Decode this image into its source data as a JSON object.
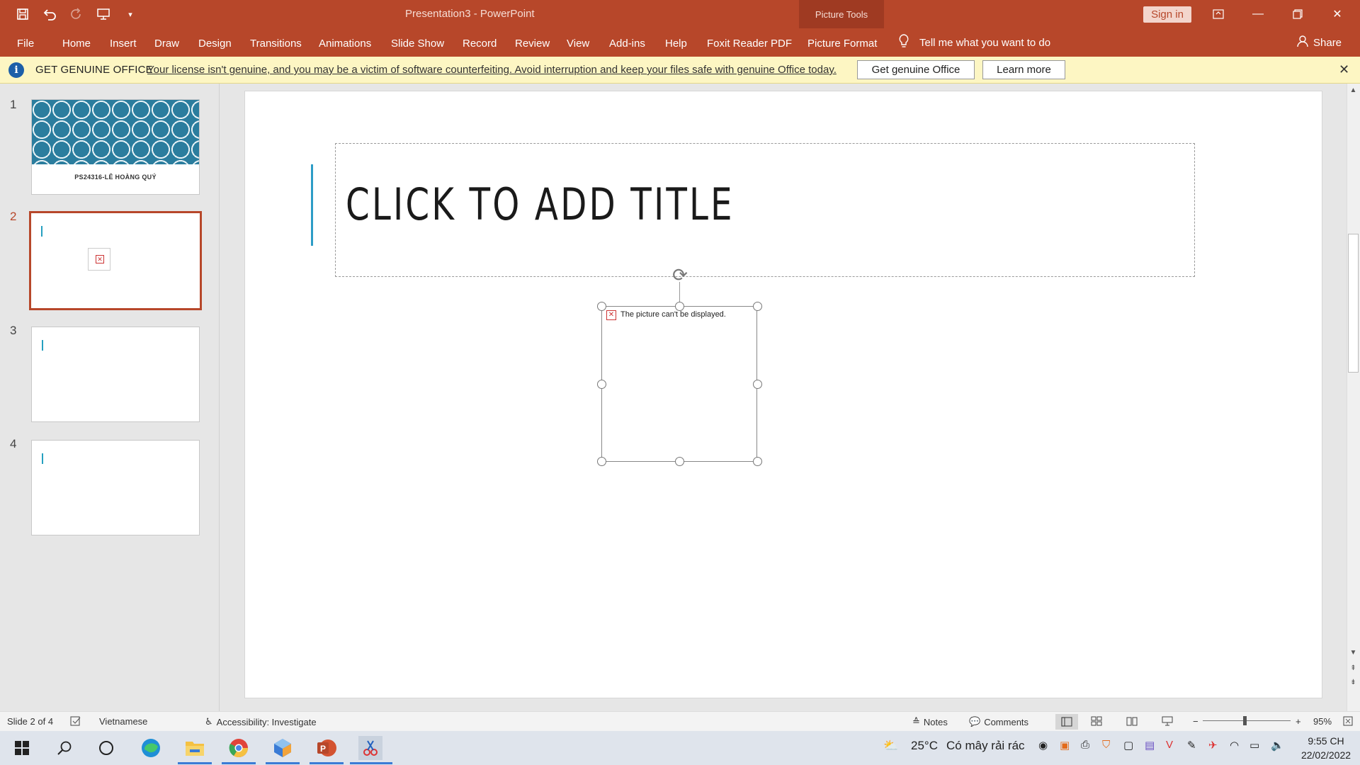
{
  "window": {
    "title": "Presentation3  -  PowerPoint",
    "context_tab_group": "Picture Tools",
    "sign_in": "Sign in"
  },
  "ribbon": {
    "tabs": [
      "File",
      "Home",
      "Insert",
      "Draw",
      "Design",
      "Transitions",
      "Animations",
      "Slide Show",
      "Record",
      "Review",
      "View",
      "Add-ins",
      "Help",
      "Foxit Reader PDF",
      "Picture Format"
    ],
    "active_tab": "Picture Format",
    "tell_me": "Tell me what you want to do",
    "share": "Share"
  },
  "message_bar": {
    "heading": "GET GENUINE OFFICE",
    "message": "Your license isn't genuine, and you may be a victim of software counterfeiting. Avoid interruption and keep your files safe with genuine Office today.",
    "primary_button": "Get genuine Office",
    "secondary_button": "Learn more"
  },
  "thumbnails": {
    "slides": [
      {
        "number": "1",
        "caption": "PS24316-LÊ HOÀNG QUÝ"
      },
      {
        "number": "2"
      },
      {
        "number": "3"
      },
      {
        "number": "4"
      }
    ],
    "selected": "2"
  },
  "slide": {
    "title_placeholder": "CLICK TO ADD TITLE",
    "broken_picture_text": "The picture can't be displayed."
  },
  "status_bar": {
    "slide_position": "Slide 2 of 4",
    "language": "Vietnamese",
    "accessibility": "Accessibility: Investigate",
    "notes": "Notes",
    "comments": "Comments",
    "zoom": "95%"
  },
  "taskbar": {
    "weather_temp": "25°C",
    "weather_desc": "Có mây rải rác",
    "time": "9:55 CH",
    "date": "22/02/2022"
  },
  "colors": {
    "accent": "#b7472a",
    "message_bar": "#fdf6c3",
    "title_accent": "#2d9cc6"
  }
}
